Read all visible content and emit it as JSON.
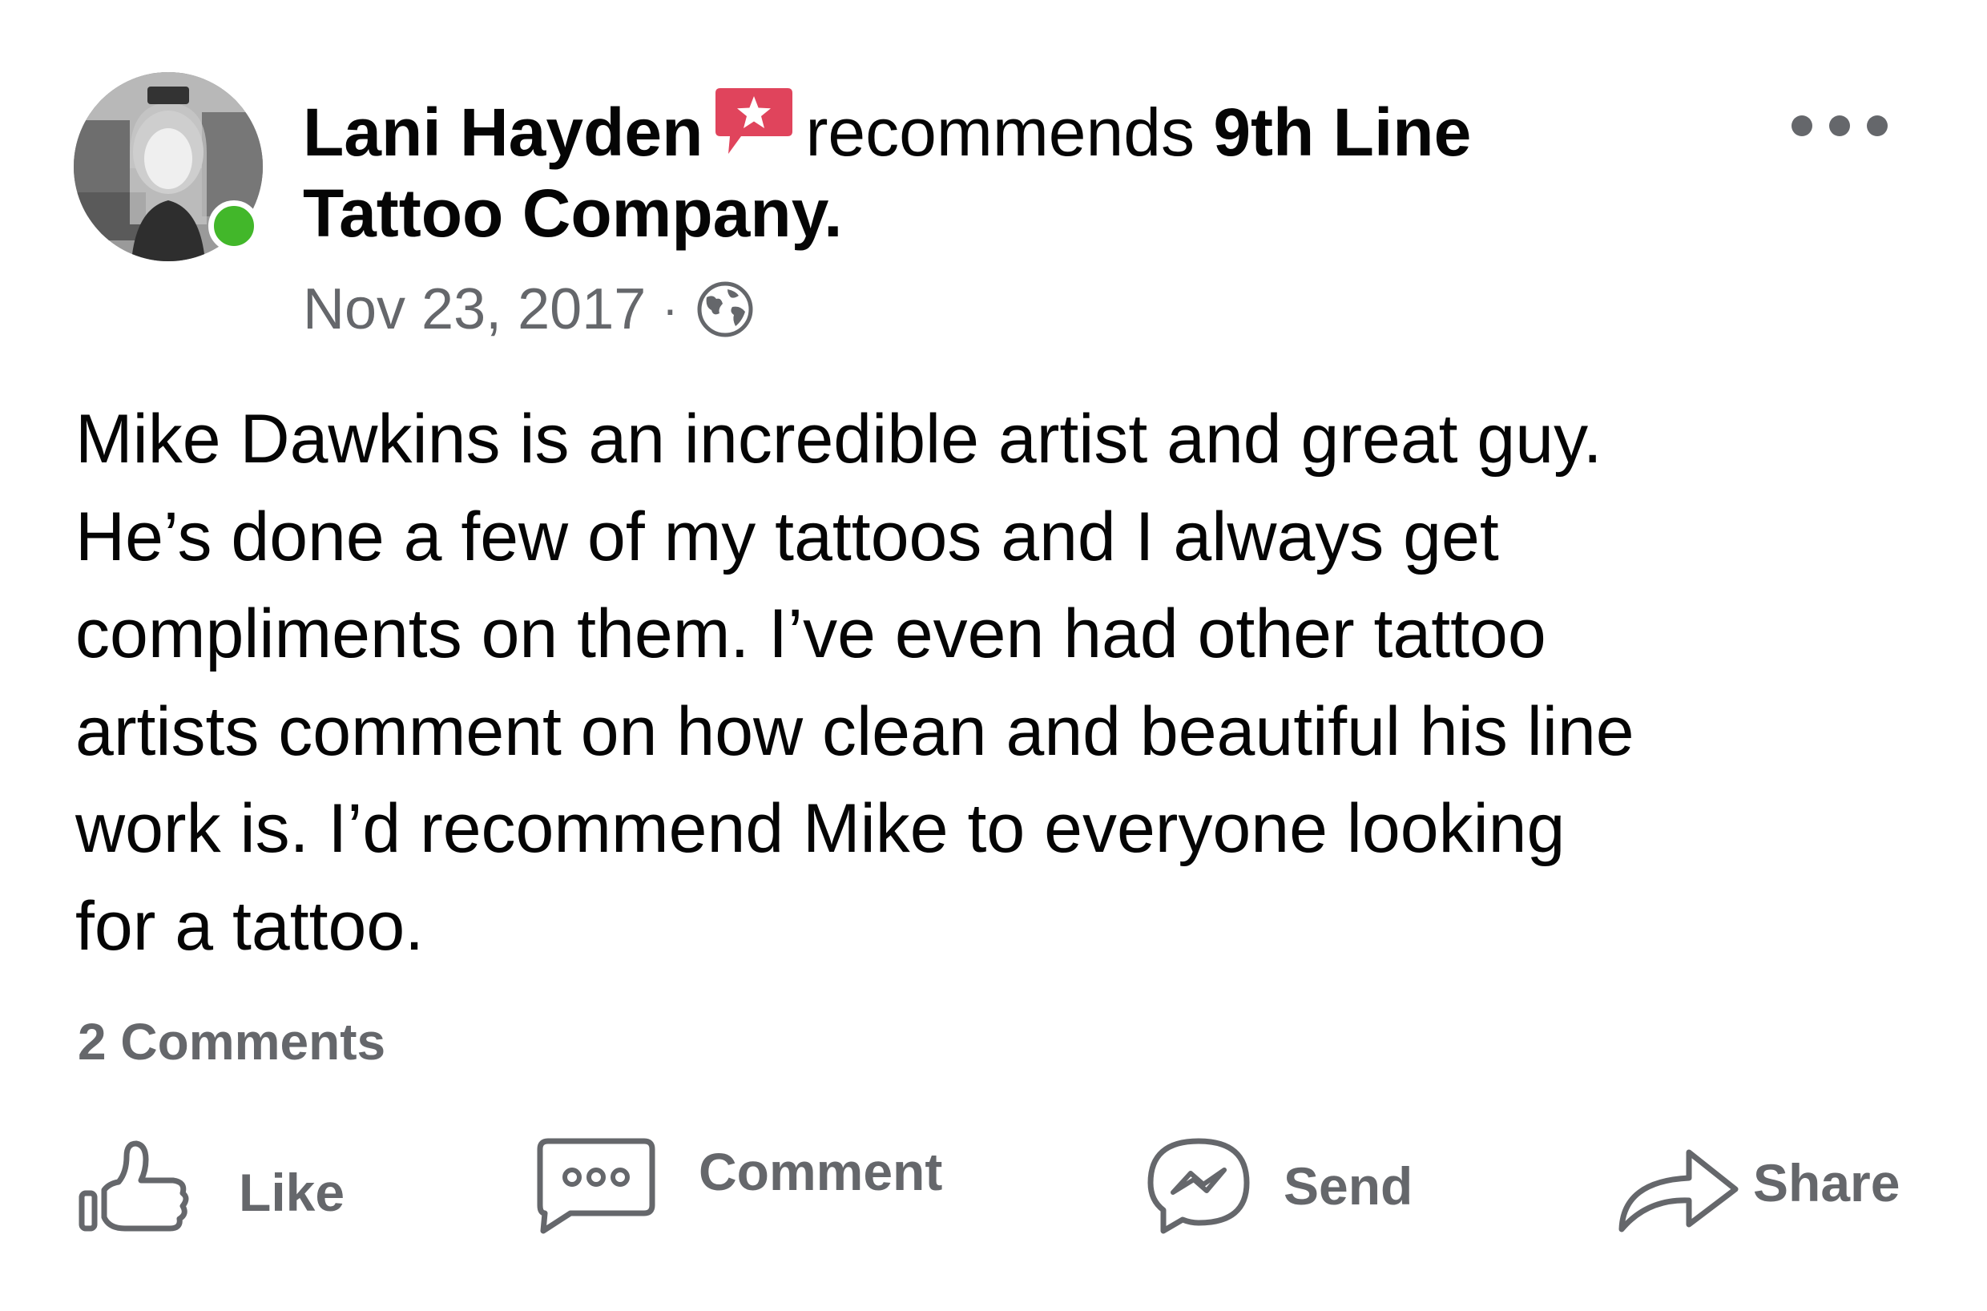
{
  "post": {
    "author": "Lani Hayden",
    "verb": "recommends",
    "page_name": "9th Line Tattoo Company.",
    "date": "Nov 23, 2017",
    "separator": "·",
    "body_lines": [
      "Mike Dawkins is an incredible artist and great guy.",
      "He’s done a few of my tattoos and I always get",
      "compliments on them. I’ve even had other tattoo",
      "artists comment on how clean and beautiful his line",
      "work is. I’d recommend Mike to everyone looking",
      "for a tattoo."
    ],
    "comments_count": "2 Comments"
  },
  "actions": {
    "like": "Like",
    "comment": "Comment",
    "send": "Send",
    "share": "Share"
  },
  "icons": {
    "recommend": "recommend-star-badge-icon",
    "privacy": "globe-icon",
    "more": "more-options-icon",
    "like": "thumbs-up-icon",
    "comment": "speech-bubble-icon",
    "send": "messenger-icon",
    "share": "share-arrow-icon"
  },
  "colors": {
    "recommend_badge": "#e0445c",
    "online": "#42b72a",
    "secondary_text": "#65676b",
    "primary_text": "#050505"
  }
}
